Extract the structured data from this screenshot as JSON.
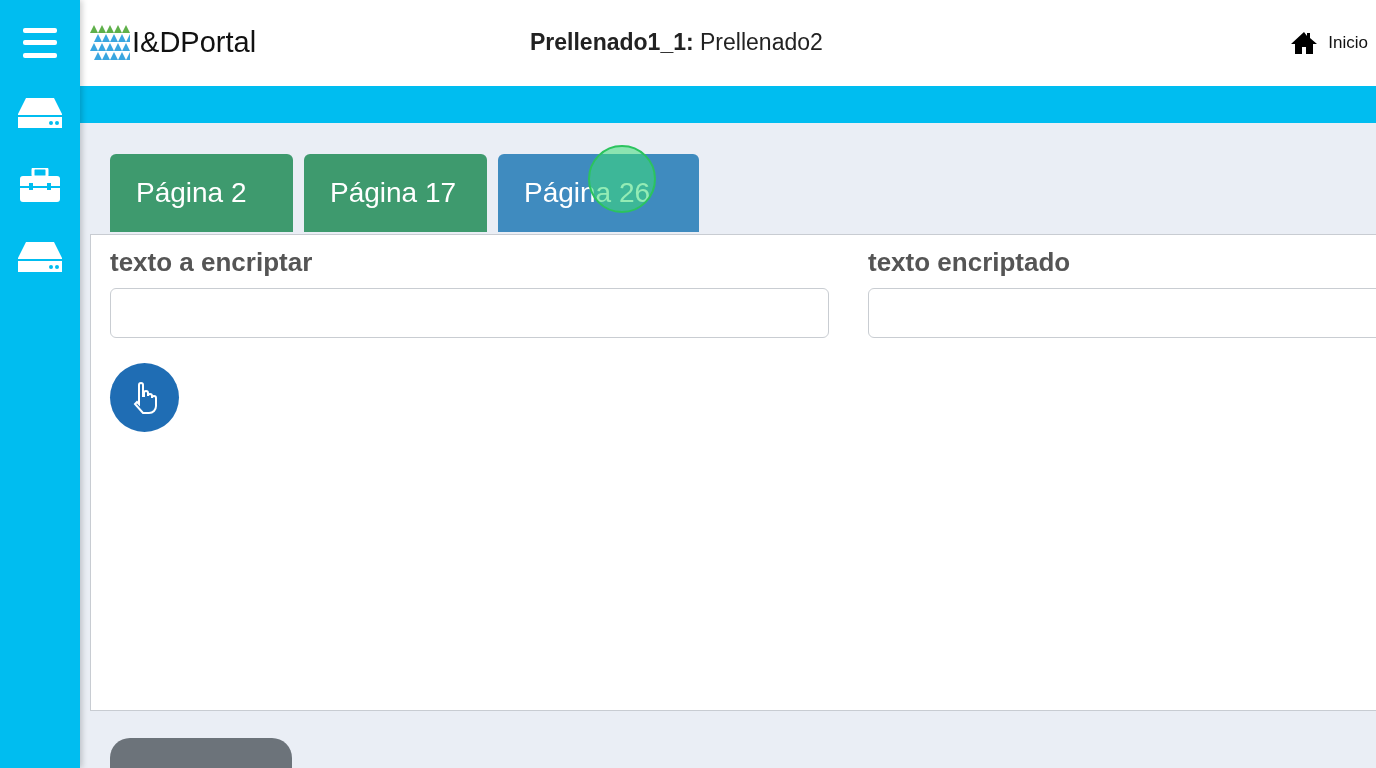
{
  "header": {
    "logo_text": "I&DPortal",
    "title_bold": "Prellenado1_1:",
    "title_rest": "Prellenado2",
    "home_link": "Inicio"
  },
  "tabs": [
    {
      "label": "Página 2",
      "selected": false
    },
    {
      "label": "Página 17",
      "selected": false
    },
    {
      "label": "Página 26",
      "selected": true
    }
  ],
  "fields": [
    {
      "label": "texto a encriptar"
    },
    {
      "label": "texto encriptado"
    }
  ]
}
